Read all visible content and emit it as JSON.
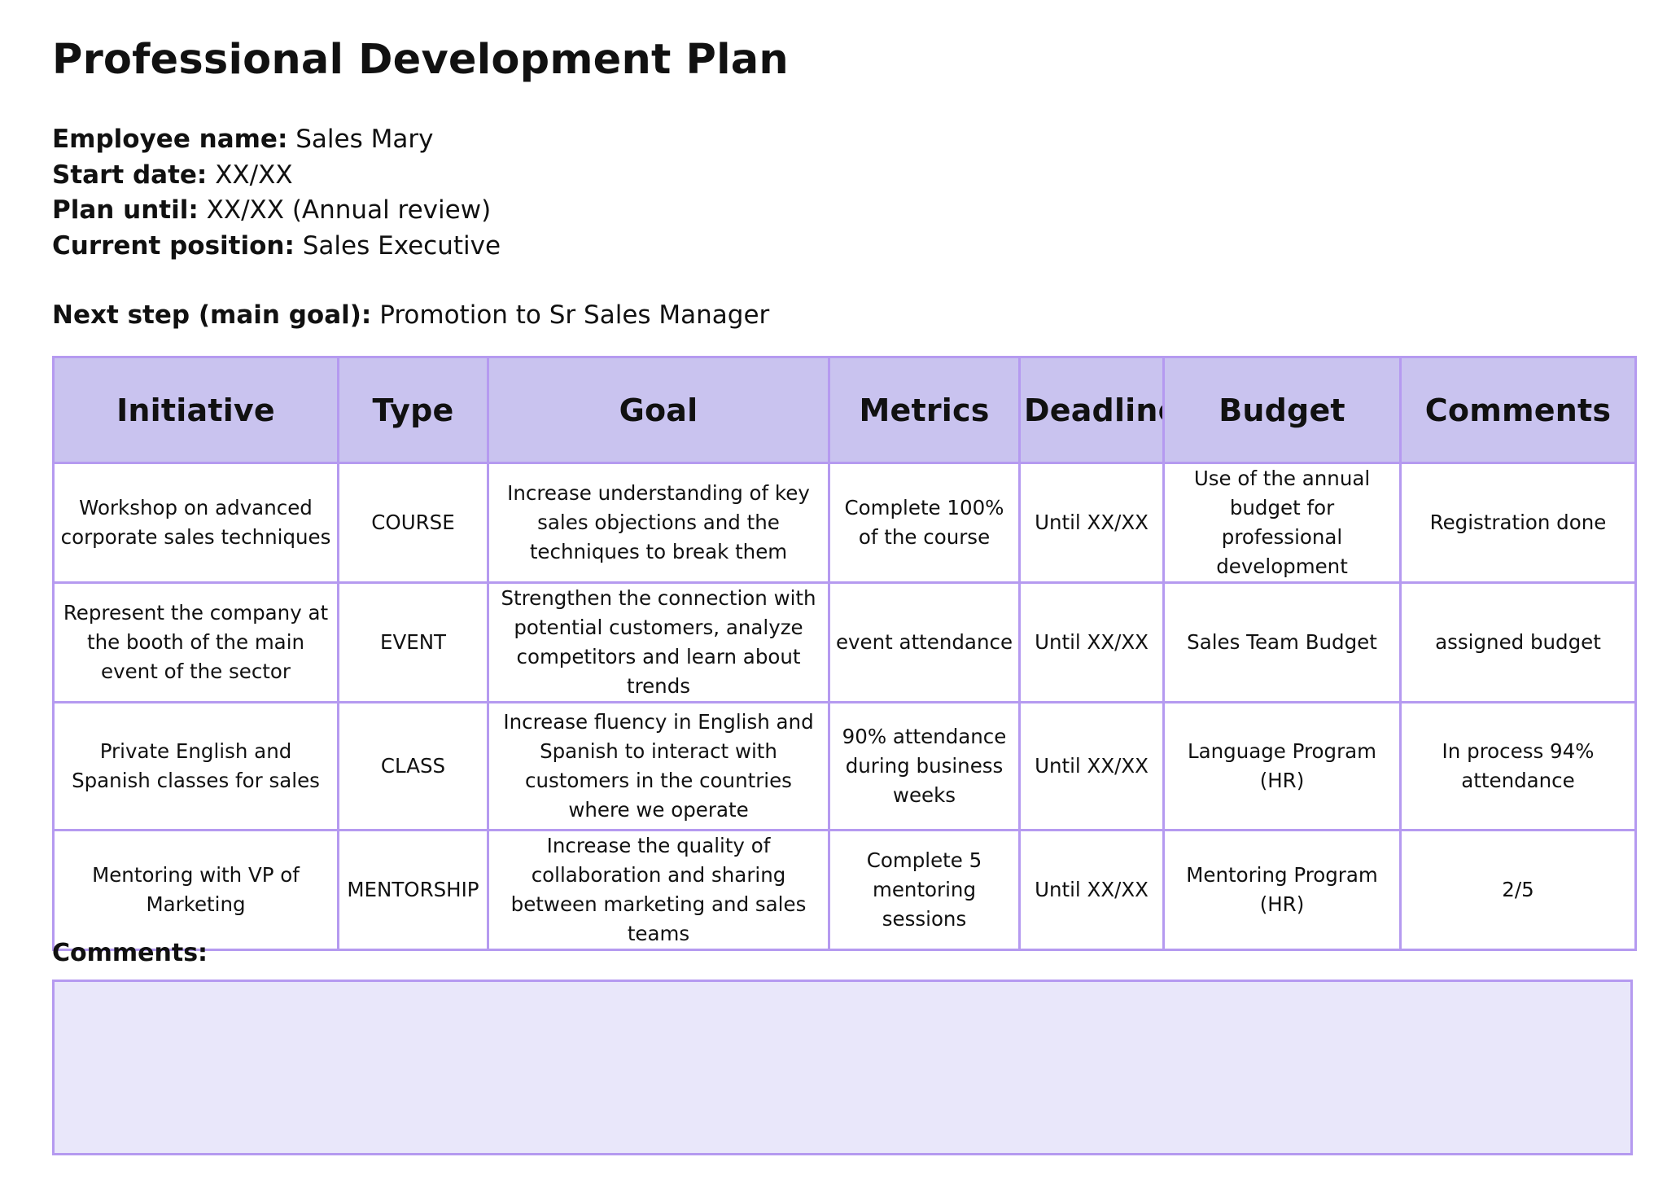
{
  "document": {
    "title": "Professional Development Plan",
    "employee_label": "Employee name:",
    "employee_value": "Sales Mary",
    "start_label": "Start date:",
    "start_value": "XX/XX",
    "plan_label": "Plan until:",
    "plan_value": "XX/XX (Annual review)",
    "position_label": "Current position:",
    "position_value": "Sales Executive",
    "goal_label": "Next step (main goal):",
    "goal_value": "Promotion to Sr Sales Manager",
    "comments_label": "Comments:",
    "comments_value": ""
  },
  "table": {
    "headers": [
      "Initiative",
      "Type",
      "Goal",
      "Metrics",
      "Deadline",
      "Budget",
      "Comments"
    ],
    "rows": [
      [
        "Workshop on advanced corporate sales techniques",
        "COURSE",
        "Increase understanding of key sales objections and the techniques to break them",
        "Complete 100% of the course",
        "Until XX/XX",
        "Use of the annual budget for professional development",
        "Registration done"
      ],
      [
        "Represent the company at the booth of the main event of the sector",
        "EVENT",
        "Strengthen the connection with potential customers, analyze competitors and learn about trends",
        "event attendance",
        "Until XX/XX",
        "Sales Team Budget",
        "assigned budget"
      ],
      [
        "Private English and Spanish classes for sales",
        "CLASS",
        "Increase fluency in English and Spanish to interact with customers in the countries where we operate",
        "90% attendance during business weeks",
        "Until XX/XX",
        "Language Program (HR)",
        "In process 94% attendance"
      ],
      [
        "Mentoring with VP of Marketing",
        "MENTORSHIP",
        "Increase the quality of collaboration and sharing between marketing and sales teams",
        "Complete 5 mentoring sessions",
        "Until XX/XX",
        "Mentoring Program (HR)",
        "2/5"
      ]
    ]
  },
  "colors": {
    "header_fill": "#c9c3ef",
    "border": "#b59af0",
    "comments_fill": "#e9e7fa",
    "text": "#111111"
  }
}
